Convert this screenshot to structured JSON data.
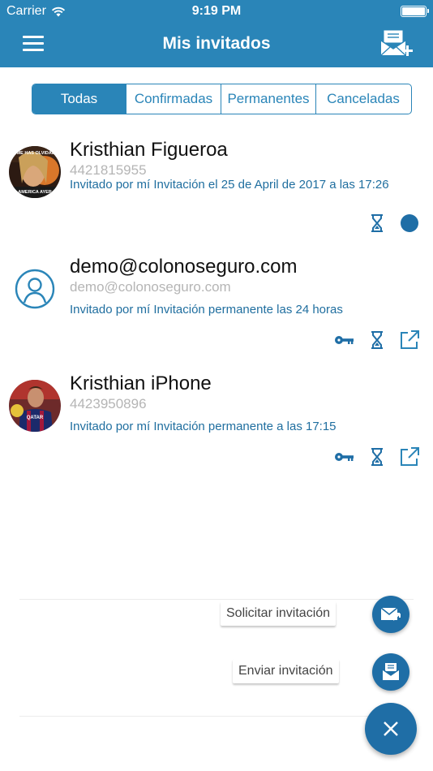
{
  "status_bar": {
    "carrier": "Carrier",
    "time": "9:19 PM"
  },
  "nav": {
    "title": "Mis invitados",
    "menu_icon": "hamburger-icon",
    "action_icon": "add-invitation-icon"
  },
  "filters": {
    "tabs": [
      {
        "label": "Todas",
        "active": true
      },
      {
        "label": "Confirmadas",
        "active": false
      },
      {
        "label": "Permanentes",
        "active": false
      },
      {
        "label": "Canceladas",
        "active": false
      }
    ]
  },
  "guests": [
    {
      "name": "Kristhian Figueroa",
      "subtitle": "4421815955",
      "detail": "Invitado por mí Invitación el  25  de  April de 2017  a las 17:26",
      "avatar_texts": [
        "SI ME HAS OLVIDADO",
        "AMERICA AYER"
      ],
      "actions": [
        "hourglass-icon",
        "status-dot-icon"
      ]
    },
    {
      "name": "demo@colonoseguro.com",
      "subtitle": "demo@colonoseguro.com",
      "detail": "Invitado por mí Invitación permanente las 24 horas",
      "avatar_texts": [],
      "actions": [
        "key-icon",
        "hourglass-icon",
        "share-icon"
      ]
    },
    {
      "name": "Kristhian iPhone",
      "subtitle": "4423950896",
      "detail": "Invitado por mí Invitación permanente  a las 17:15",
      "avatar_texts": [],
      "actions": [
        "key-icon",
        "hourglass-icon",
        "share-icon"
      ]
    }
  ],
  "fab_menu": {
    "request_label": "Solicitar invitación",
    "send_label": "Enviar invitación",
    "close_icon": "close-icon"
  },
  "colors": {
    "primary": "#2a85b8",
    "fab": "#1f6ea6",
    "detail_text": "#1f6e9f",
    "subtitle_text": "#b5b5b5"
  }
}
